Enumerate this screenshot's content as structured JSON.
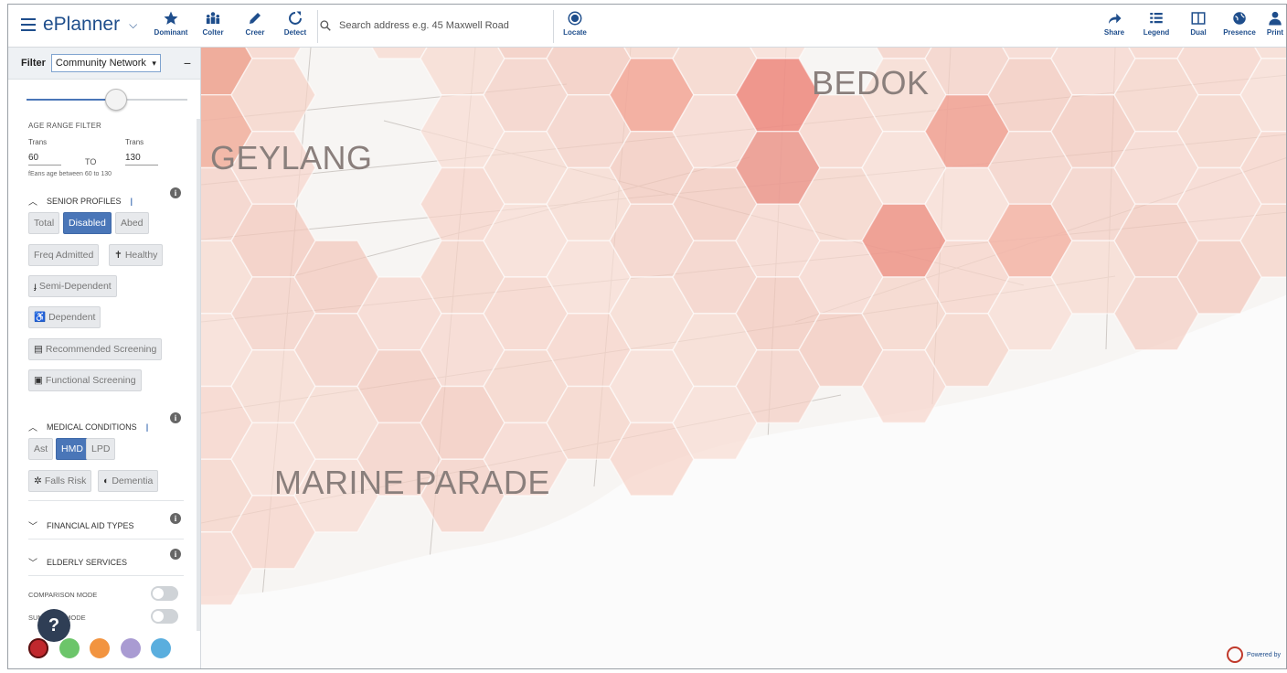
{
  "app": {
    "brand": "ePlanner"
  },
  "toolbar": {
    "tools": [
      {
        "label": "Dominant"
      },
      {
        "label": "Colter"
      },
      {
        "label": "Creer"
      },
      {
        "label": "Detect"
      }
    ],
    "search_placeholder": "Search address e.g. 45 Maxwell Road",
    "locate_label": "Locate",
    "right_tools": [
      {
        "label": "Share"
      },
      {
        "label": "Legend"
      },
      {
        "label": "Dual"
      },
      {
        "label": "Presence"
      },
      {
        "label": "Print"
      }
    ]
  },
  "sidebar": {
    "filter_label": "Filter",
    "filter_select": "Community Network",
    "collapse": "−",
    "slider": {
      "value": 0.55
    },
    "age": {
      "heading": "AGE RANGE FILTER",
      "from_label": "Trans",
      "to_label": "Trans",
      "from": "60",
      "sep": "TO",
      "to": "130",
      "note": "fEans age between 60 to 130"
    },
    "senior_profiles": {
      "title": "SENIOR PROFILES",
      "chips": [
        {
          "label": "Total",
          "glyph": "",
          "active": false
        },
        {
          "label": "Disabled",
          "glyph": "",
          "active": true
        },
        {
          "label": "Abed",
          "glyph": "",
          "active": false
        },
        {
          "label": "Freq Admitted",
          "glyph": "",
          "active": false
        },
        {
          "label": "Healthy",
          "glyph": "✝",
          "active": false
        },
        {
          "label": "Semi-Dependent",
          "glyph": "ɟ",
          "active": false
        },
        {
          "label": "Dependent",
          "glyph": "♿",
          "active": false
        },
        {
          "label": "Recommended Screening",
          "glyph": "▤",
          "active": false
        },
        {
          "label": "Functional Screening",
          "glyph": "▣",
          "active": false
        }
      ]
    },
    "medical": {
      "title": "MEDICAL CONDITIONS",
      "chips": [
        {
          "label": "Ast",
          "glyph": "",
          "active": false
        },
        {
          "label": "HMD",
          "glyph": "",
          "active": true
        },
        {
          "label": "LPD",
          "glyph": "",
          "active": false
        },
        {
          "label": "Falls Risk",
          "glyph": "✲",
          "active": false
        },
        {
          "label": "Dementia",
          "glyph": "◐",
          "active": false
        }
      ]
    },
    "financial": {
      "title": "FINANCIAL AID TYPES"
    },
    "elderly": {
      "title": "ELDERLY SERVICES"
    },
    "modes": [
      {
        "label": "COMPARISON MODE",
        "on": false
      },
      {
        "label": "SUMMARY MODE",
        "on": false
      }
    ],
    "colors": [
      "#c0282d",
      "#6cc56a",
      "#f29440",
      "#a99bd2",
      "#5aaede"
    ],
    "help": "?"
  },
  "map": {
    "districts": [
      "BEDOK",
      "GEYLANG",
      "MARINE PARADE"
    ],
    "attribution": "Powered by"
  }
}
